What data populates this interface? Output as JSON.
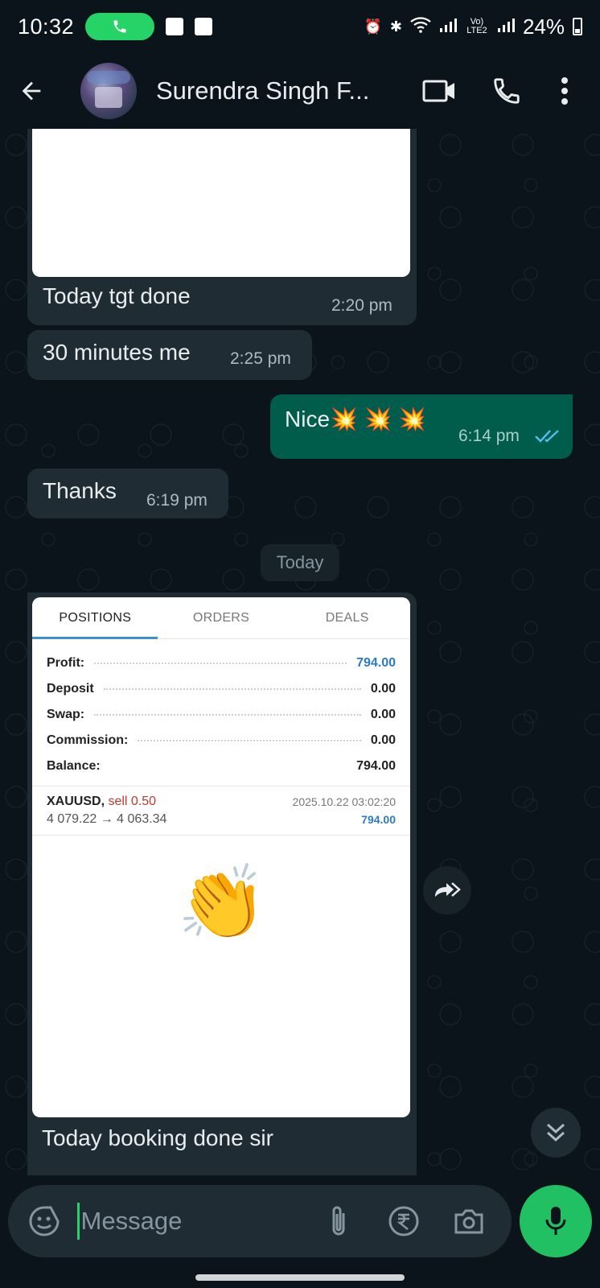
{
  "status_bar": {
    "time": "10:32",
    "network_labels": "Vo) LTE2",
    "battery": "24%"
  },
  "header": {
    "contact_name": "Surendra Singh F...",
    "icons": [
      "back-arrow-icon",
      "video-call-icon",
      "voice-call-icon",
      "more-options-icon"
    ]
  },
  "messages": [
    {
      "direction": "incoming",
      "text": "Today tgt done",
      "time": "2:20 pm",
      "has_image": true
    },
    {
      "direction": "incoming",
      "text": "30 minutes me",
      "time": "2:25 pm"
    },
    {
      "direction": "outgoing",
      "text": "Nice💥 💥 💥",
      "time": "6:14 pm",
      "status": "read"
    },
    {
      "direction": "incoming",
      "text": "Thanks",
      "time": "6:19 pm"
    },
    {
      "direction": "incoming",
      "text": "Today booking  done sir",
      "has_image": true
    }
  ],
  "date_divider": "Today",
  "trade_screenshot": {
    "tabs": [
      "POSITIONS",
      "ORDERS",
      "DEALS"
    ],
    "active_tab": "POSITIONS",
    "summary": [
      {
        "label": "Profit:",
        "value": "794.00",
        "highlight": true
      },
      {
        "label": "Deposit",
        "value": "0.00"
      },
      {
        "label": "Swap:",
        "value": "0.00"
      },
      {
        "label": "Commission:",
        "value": "0.00"
      },
      {
        "label": "Balance:",
        "value": "794.00"
      }
    ],
    "position": {
      "symbol": "XAUUSD,",
      "side": "sell 0.50",
      "datetime": "2025.10.22 03:02:20",
      "prices": "4 079.22 → 4 063.34",
      "profit": "794.00"
    },
    "sticker": "👏"
  },
  "composer": {
    "placeholder": "Message"
  },
  "colors": {
    "background": "#0b141a",
    "incoming_bubble": "#202c33",
    "outgoing_bubble": "#005c4b",
    "accent_green": "#21c063",
    "read_tick": "#53bdeb"
  }
}
